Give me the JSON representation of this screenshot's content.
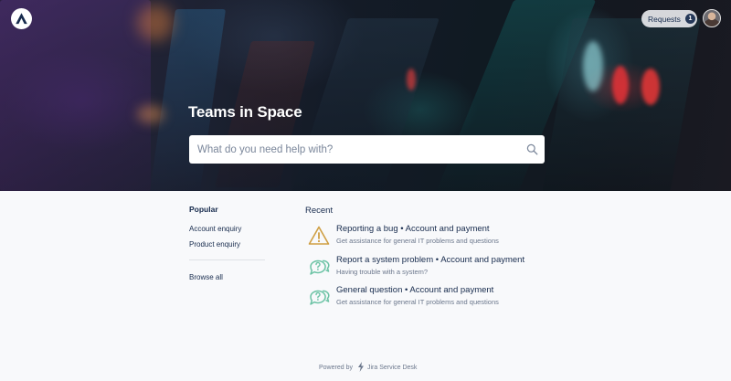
{
  "header": {
    "requests_label": "Requests",
    "requests_count": "1",
    "logo_icon": "atlassian-logo-icon",
    "avatar_icon": "user-avatar"
  },
  "hero": {
    "title": "Teams in Space",
    "search_placeholder": "What do you need help with?",
    "search_value": "",
    "search_icon": "search-icon"
  },
  "popular": {
    "title": "Popular",
    "links": [
      "Account enquiry",
      "Product enquiry"
    ],
    "browse_all": "Browse all"
  },
  "recent": {
    "title": "Recent",
    "items": [
      {
        "title": "Reporting a bug • Account and payment",
        "subtitle": "Get assistance for general IT problems and questions",
        "icon": "warning-triangle-icon",
        "icon_color": "#cf9f44"
      },
      {
        "title": "Report a system problem • Account and payment",
        "subtitle": "Having trouble with a system?",
        "icon": "question-bubble-icon",
        "icon_color": "#6cc3a5"
      },
      {
        "title": "General question • Account and payment",
        "subtitle": "Get assistance for general IT problems and questions",
        "icon": "question-bubble-icon",
        "icon_color": "#6cc3a5"
      }
    ]
  },
  "footer": {
    "powered_by": "Powered by",
    "product": "Jira Service Desk"
  }
}
